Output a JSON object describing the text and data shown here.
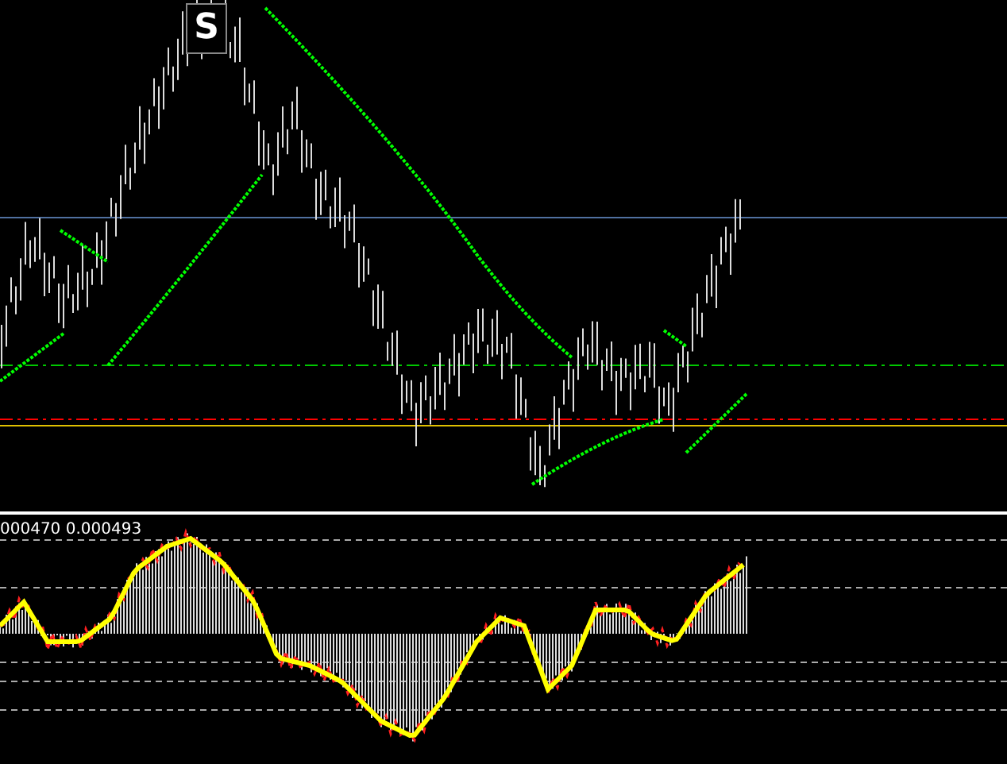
{
  "price_panel": {
    "signal_label": "S"
  },
  "oscillator_panel": {
    "values_label": "000470 0.000493"
  }
}
